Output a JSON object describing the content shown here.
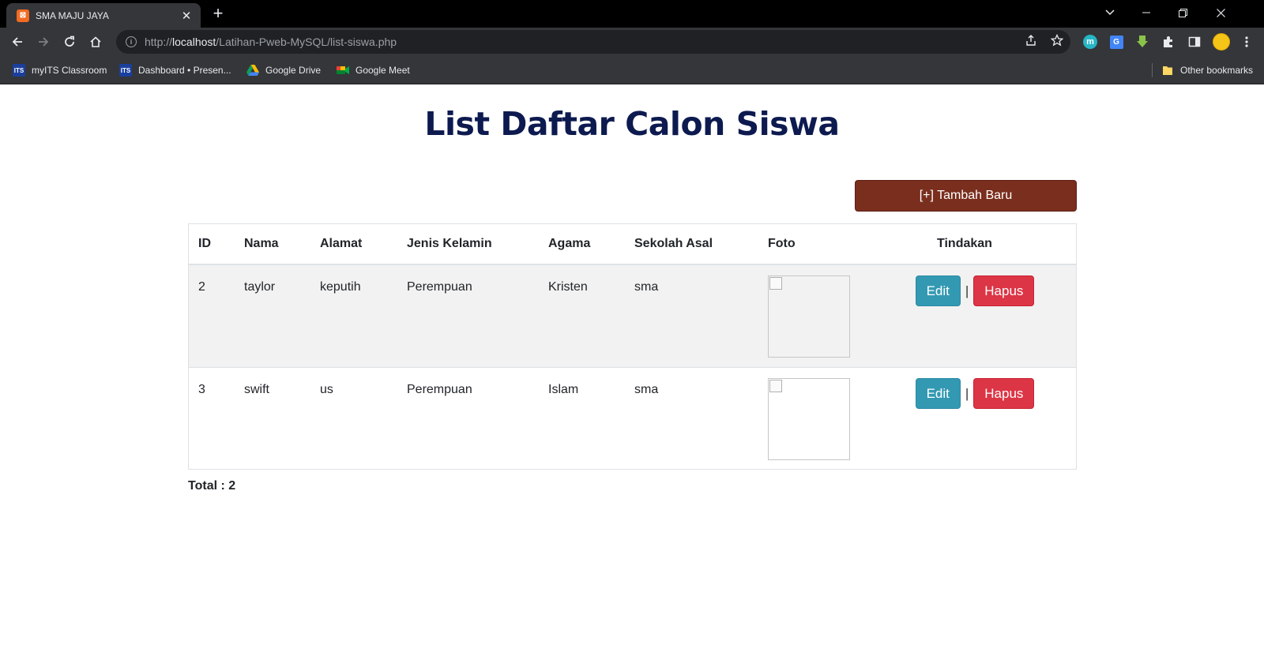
{
  "browser": {
    "tab_title": "SMA MAJU JAYA",
    "url_prefix": "http://",
    "url_host": "localhost",
    "url_path": "/Latihan-Pweb-MySQL/list-siswa.php",
    "bookmarks": [
      {
        "label": "myITS Classroom",
        "icon": "its-icon"
      },
      {
        "label": "Dashboard • Presen...",
        "icon": "its-icon"
      },
      {
        "label": "Google Drive",
        "icon": "google-drive-icon"
      },
      {
        "label": "Google Meet",
        "icon": "google-meet-icon"
      }
    ],
    "other_bookmarks": "Other bookmarks"
  },
  "page": {
    "title": "List Daftar Calon Siswa",
    "add_button": "[+] Tambah Baru",
    "columns": [
      "ID",
      "Nama",
      "Alamat",
      "Jenis Kelamin",
      "Agama",
      "Sekolah Asal",
      "Foto",
      "Tindakan"
    ],
    "rows": [
      {
        "id": "2",
        "nama": "taylor",
        "alamat": "keputih",
        "jenis_kelamin": "Perempuan",
        "agama": "Kristen",
        "sekolah_asal": "sma"
      },
      {
        "id": "3",
        "nama": "swift",
        "alamat": "us",
        "jenis_kelamin": "Perempuan",
        "agama": "Islam",
        "sekolah_asal": "sma"
      }
    ],
    "edit_label": "Edit",
    "separator": "|",
    "delete_label": "Hapus",
    "total": "Total : 2"
  },
  "colors": {
    "title": "#0d1a4f",
    "add_button": "#7a2e1e",
    "edit_button": "#3399b3",
    "delete_button": "#dc3545"
  }
}
